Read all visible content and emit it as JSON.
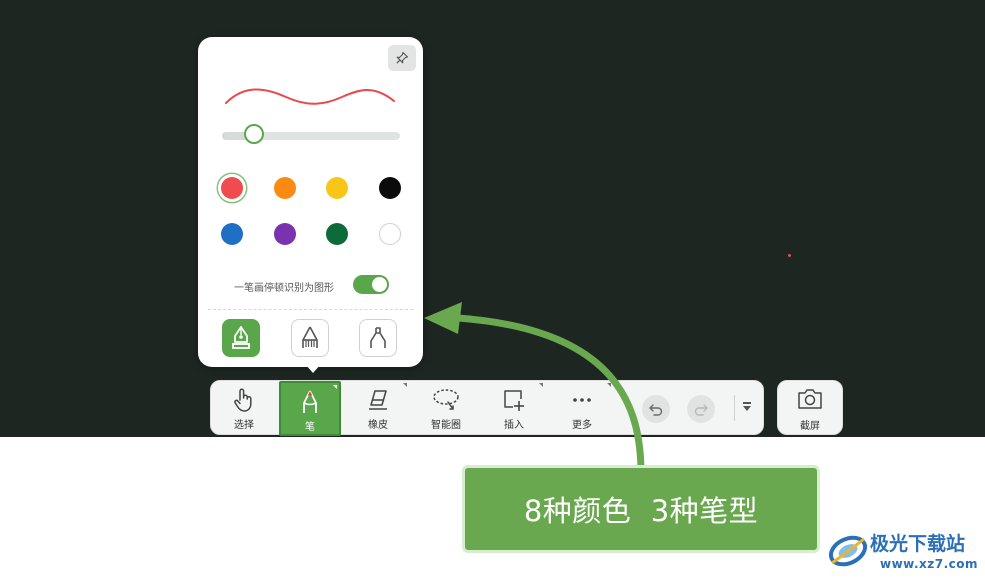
{
  "popup": {
    "stroke_color": "#e8494f",
    "thickness_fraction": 0.18,
    "colors": [
      {
        "name": "red",
        "hex": "#f04b4f",
        "selected": true
      },
      {
        "name": "orange",
        "hex": "#fb8a12",
        "selected": false
      },
      {
        "name": "yellow",
        "hex": "#f7c617",
        "selected": false
      },
      {
        "name": "black",
        "hex": "#0b0b0b",
        "selected": false
      },
      {
        "name": "blue",
        "hex": "#1f6fc5",
        "selected": false
      },
      {
        "name": "purple",
        "hex": "#7b32b1",
        "selected": false
      },
      {
        "name": "green",
        "hex": "#0d6b3a",
        "selected": false
      },
      {
        "name": "white",
        "hex": "#ffffff",
        "selected": false
      }
    ],
    "recognize_label": "一笔画停顿识别为图形",
    "recognize_enabled": true,
    "pen_types": [
      {
        "icon": "fountain-pen-icon",
        "active": true
      },
      {
        "icon": "brush-pen-icon",
        "active": false
      },
      {
        "icon": "marker-pen-icon",
        "active": false
      }
    ]
  },
  "toolbar": {
    "tools": [
      {
        "id": "select",
        "label": "选择",
        "icon": "hand-pointer-icon",
        "active": false
      },
      {
        "id": "pen",
        "label": "笔",
        "icon": "pen-icon",
        "active": true
      },
      {
        "id": "eraser",
        "label": "橡皮",
        "icon": "eraser-icon",
        "active": false
      },
      {
        "id": "smart-lasso",
        "label": "智能圈",
        "icon": "lasso-icon",
        "active": false
      },
      {
        "id": "insert",
        "label": "插入",
        "icon": "insert-plus-icon",
        "active": false
      },
      {
        "id": "more",
        "label": "更多",
        "icon": "more-dots-icon",
        "active": false
      }
    ],
    "undo_icon": "undo-icon",
    "redo_icon": "redo-icon",
    "collapse_icon": "collapse-arrow-icon"
  },
  "screenshot": {
    "label": "截屏",
    "icon": "camera-icon"
  },
  "callout": {
    "text": "8种颜色  3种笔型",
    "color": "#6aa84f"
  },
  "watermark": {
    "main": "极光下载站",
    "sub": "www.xz7.com"
  },
  "colors": {
    "board": "#1d2620",
    "accent_green": "#5aa64b"
  }
}
